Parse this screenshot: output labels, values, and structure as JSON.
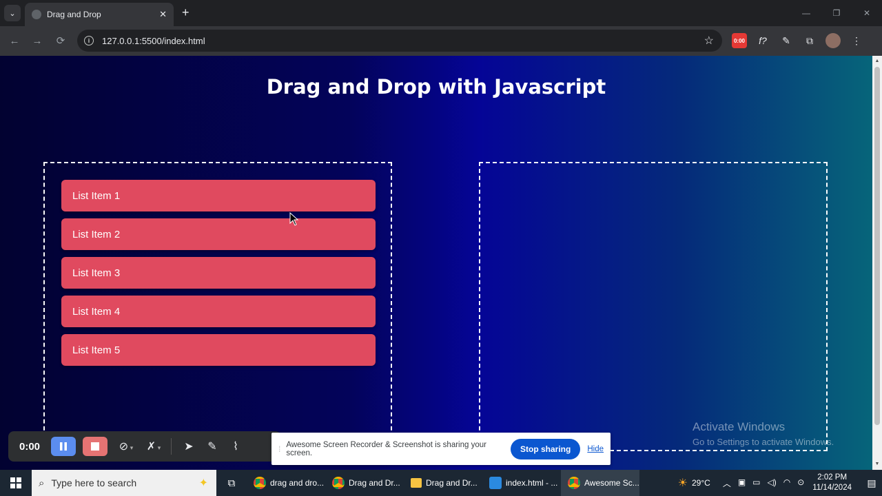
{
  "browser": {
    "tab_title": "Drag and Drop",
    "tab_close": "✕",
    "new_tab": "+",
    "url": "127.0.0.1:5500/index.html",
    "recorder_badge": "0:00"
  },
  "page": {
    "title": "Drag and Drop with Javascript",
    "left_zone_items": [
      "List Item 1",
      "List Item 2",
      "List Item 3",
      "List Item 4",
      "List Item 5"
    ],
    "accent_color": "#e04a5f"
  },
  "watermark": {
    "title": "Activate Windows",
    "subtitle": "Go to Settings to activate Windows."
  },
  "recorder": {
    "time": "0:00"
  },
  "share_banner": {
    "text": "Awesome Screen Recorder & Screenshot is sharing your screen.",
    "stop_label": "Stop sharing",
    "hide_label": "Hide"
  },
  "taskbar": {
    "search_placeholder": "Type here to search",
    "items": [
      {
        "label": "drag and dro...",
        "icon": "chrome-icon"
      },
      {
        "label": "Drag and Dr...",
        "icon": "chrome-icon"
      },
      {
        "label": "Drag and Dr...",
        "icon": "folder-icon"
      },
      {
        "label": "index.html - ...",
        "icon": "vscode-icon"
      },
      {
        "label": "Awesome Sc...",
        "icon": "chrome-icon"
      }
    ],
    "temperature": "29°C",
    "time": "2:02 PM",
    "date": "11/14/2024"
  }
}
